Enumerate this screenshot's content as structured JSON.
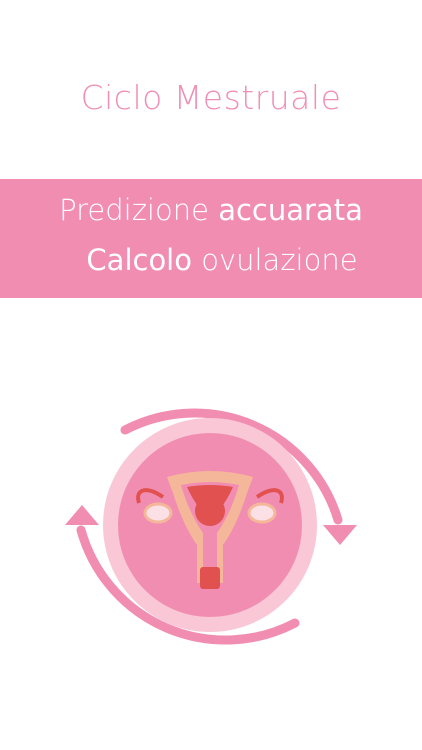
{
  "header": {
    "title": "Ciclo Mestruale"
  },
  "banner": {
    "line1_regular": "Predizione",
    "line1_strong": "accuarata",
    "line2_strong": "Calcolo",
    "line2_regular": "ovulazione"
  },
  "colors": {
    "brand_pink": "#f28db2",
    "title_pink": "#f08fb5",
    "disc_outer": "#f9c7d6",
    "disc_inner": "#f28db2",
    "organ_skin": "#f5b79a",
    "organ_red": "#e0514f"
  },
  "illustration": {
    "icon": "uterus-cycle-icon"
  }
}
